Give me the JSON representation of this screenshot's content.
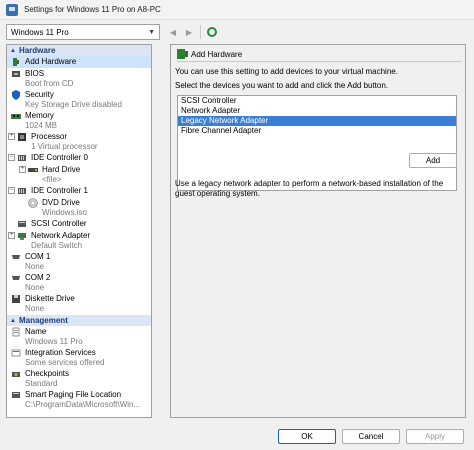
{
  "window": {
    "title": "Settings for Windows 11 Pro on A8-PC"
  },
  "vm_selector": {
    "value": "Windows 11 Pro"
  },
  "nav": {
    "back": "◀",
    "forward": "▶"
  },
  "hardware_section": {
    "label": "Hardware",
    "items": [
      {
        "label": "Add Hardware",
        "sub": ""
      },
      {
        "label": "BIOS",
        "sub": "Boot from CD"
      },
      {
        "label": "Security",
        "sub": "Key Storage Drive disabled"
      },
      {
        "label": "Memory",
        "sub": "1024 MB"
      },
      {
        "label": "Processor",
        "sub": "1 Virtual processor"
      },
      {
        "label": "IDE Controller 0",
        "sub": ""
      },
      {
        "label": "Hard Drive",
        "sub": "<file>"
      },
      {
        "label": "IDE Controller 1",
        "sub": ""
      },
      {
        "label": "DVD Drive",
        "sub": "Windows.iso"
      },
      {
        "label": "SCSI Controller",
        "sub": ""
      },
      {
        "label": "Network Adapter",
        "sub": "Default Switch"
      },
      {
        "label": "COM 1",
        "sub": "None"
      },
      {
        "label": "COM 2",
        "sub": "None"
      },
      {
        "label": "Diskette Drive",
        "sub": "None"
      }
    ]
  },
  "management_section": {
    "label": "Management",
    "items": [
      {
        "label": "Name",
        "sub": "Windows 11 Pro"
      },
      {
        "label": "Integration Services",
        "sub": "Some services offered"
      },
      {
        "label": "Checkpoints",
        "sub": "Standard"
      },
      {
        "label": "Smart Paging File Location",
        "sub": "C:\\ProgramData\\Microsoft\\Win..."
      }
    ]
  },
  "detail": {
    "heading": "Add Hardware",
    "intro": "You can use this setting to add devices to your virtual machine.",
    "select_prompt": "Select the devices you want to add and click the Add button.",
    "devices": [
      "SCSI Controller",
      "Network Adapter",
      "Legacy Network Adapter",
      "Fibre Channel Adapter"
    ],
    "selected_index": 2,
    "add_button": "Add",
    "info": "Use a legacy network adapter to perform a network-based installation of the guest operating system."
  },
  "footer": {
    "ok": "OK",
    "cancel": "Cancel",
    "apply": "Apply"
  },
  "colors": {
    "section_header_bg": "#dbe5f4",
    "selected_item_bg": "#3b7ed4",
    "tree_selection_bg": "#cfe3fa"
  }
}
